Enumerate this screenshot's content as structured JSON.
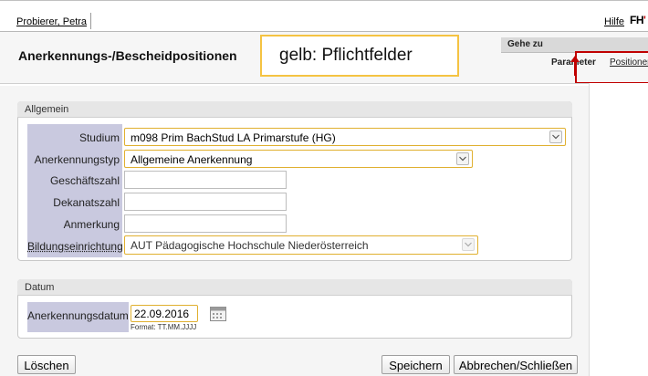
{
  "topbar": {
    "user": "Probierer, Petra",
    "help": "Hilfe",
    "logo": "FH",
    "logo_accent": "#c00000"
  },
  "header": {
    "title": "Anerkennungs-/Bescheidpositionen",
    "note": "gelb: Pflichtfelder",
    "goto_label": "Gehe zu",
    "tab_parameter": "Parameter",
    "tab_positionen": "Positionen"
  },
  "allgemein": {
    "title": "Allgemein",
    "studium_label": "Studium",
    "studium_value": "m098 Prim BachStud LA Primarstufe (HG)",
    "typ_label": "Anerkennungstyp",
    "typ_value": "Allgemeine Anerkennung",
    "gz_label": "Geschäftszahl",
    "gz_value": "",
    "dz_label": "Dekanatszahl",
    "dz_value": "",
    "anm_label": "Anmerkung",
    "anm_value": "",
    "bildung_label": "Bildungseinrichtung",
    "bildung_value": "AUT Pädagogische Hochschule Niederösterreich"
  },
  "datum": {
    "title": "Datum",
    "label": "Anerkennungsdatum",
    "value": "22.09.2016",
    "format_hint": "Format: TT.MM.JJJJ"
  },
  "buttons": {
    "delete": "Löschen",
    "save": "Speichern",
    "cancel": "Abbrechen/Schließen"
  },
  "colors": {
    "required_border": "#e0b030",
    "label_column": "#c9c9df",
    "annotation_box": "#f5c342",
    "annotation_red": "#c00000"
  }
}
